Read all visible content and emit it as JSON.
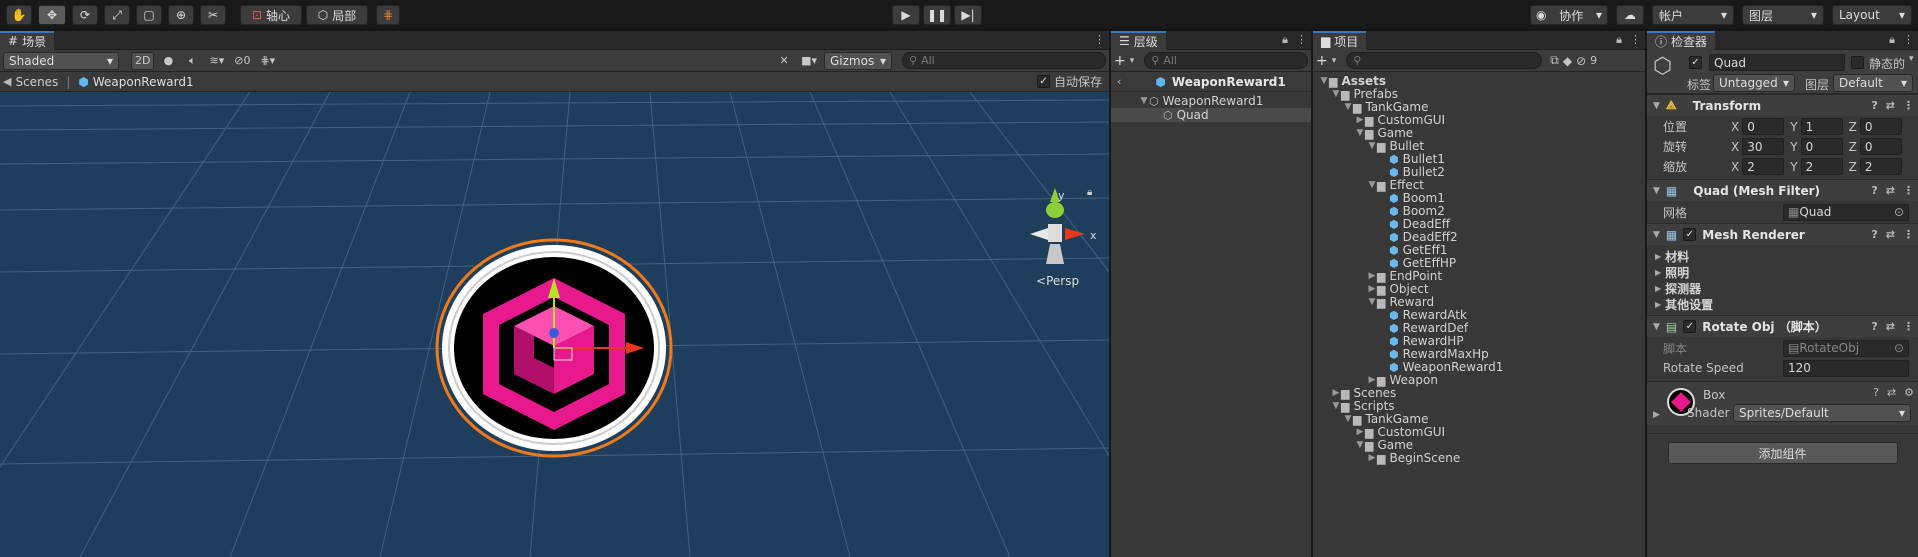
{
  "toolbar": {
    "pivot_label": "轴心",
    "local_label": "局部",
    "collab_label": "协作",
    "account_label": "帐户",
    "layers_label": "图层",
    "layout_label": "Layout"
  },
  "scene": {
    "tab_label": "场景",
    "shading": "Shaded",
    "mode_2d": "2D",
    "hidden_count": "0",
    "gizmos_label": "Gizmos",
    "search_placeholder": "All",
    "breadcrumb_root": "Scenes",
    "breadcrumb_prefab": "WeaponReward1",
    "autosave_label": "自动保存",
    "persp_label": "Persp",
    "gizmo_y": "y",
    "gizmo_x": "x"
  },
  "hierarchy": {
    "tab_label": "层级",
    "search_placeholder": "All",
    "prefab_header": "WeaponReward1",
    "items": [
      {
        "label": "WeaponReward1",
        "depth": 0
      },
      {
        "label": "Quad",
        "depth": 1
      }
    ]
  },
  "project": {
    "tab_label": "项目",
    "hidden_count": "9",
    "tree": [
      {
        "label": "Assets",
        "depth": 0,
        "open": true,
        "bold": true
      },
      {
        "label": "Prefabs",
        "depth": 1,
        "open": true
      },
      {
        "label": "TankGame",
        "depth": 2,
        "open": true
      },
      {
        "label": "CustomGUI",
        "depth": 3,
        "open": false
      },
      {
        "label": "Game",
        "depth": 3,
        "open": true
      },
      {
        "label": "Bullet",
        "depth": 4,
        "open": true
      },
      {
        "label": "Bullet1",
        "depth": 5,
        "asset": true
      },
      {
        "label": "Bullet2",
        "depth": 5,
        "asset": true
      },
      {
        "label": "Effect",
        "depth": 4,
        "open": true
      },
      {
        "label": "Boom1",
        "depth": 5,
        "asset": true
      },
      {
        "label": "Boom2",
        "depth": 5,
        "asset": true
      },
      {
        "label": "DeadEff",
        "depth": 5,
        "asset": true
      },
      {
        "label": "DeadEff2",
        "depth": 5,
        "asset": true
      },
      {
        "label": "GetEff1",
        "depth": 5,
        "asset": true
      },
      {
        "label": "GetEffHP",
        "depth": 5,
        "asset": true
      },
      {
        "label": "EndPoint",
        "depth": 4,
        "open": false
      },
      {
        "label": "Object",
        "depth": 4,
        "open": false
      },
      {
        "label": "Reward",
        "depth": 4,
        "open": true
      },
      {
        "label": "RewardAtk",
        "depth": 5,
        "asset": true
      },
      {
        "label": "RewardDef",
        "depth": 5,
        "asset": true
      },
      {
        "label": "RewardHP",
        "depth": 5,
        "asset": true
      },
      {
        "label": "RewardMaxHp",
        "depth": 5,
        "asset": true
      },
      {
        "label": "WeaponReward1",
        "depth": 5,
        "asset": true
      },
      {
        "label": "Weapon",
        "depth": 4,
        "open": false
      },
      {
        "label": "Scenes",
        "depth": 1,
        "open": false
      },
      {
        "label": "Scripts",
        "depth": 1,
        "open": true
      },
      {
        "label": "TankGame",
        "depth": 2,
        "open": true
      },
      {
        "label": "CustomGUI",
        "depth": 3,
        "open": false
      },
      {
        "label": "Game",
        "depth": 3,
        "open": true
      },
      {
        "label": "BeginScene",
        "depth": 4,
        "open": false
      }
    ]
  },
  "inspector": {
    "tab_label": "检查器",
    "object_name": "Quad",
    "static_label": "静态的",
    "tag_label": "标签",
    "tag_value": "Untagged",
    "layer_label": "图层",
    "layer_value": "Default",
    "transform": {
      "title": "Transform",
      "position_label": "位置",
      "rotation_label": "旋转",
      "scale_label": "缩放",
      "position": {
        "x": "0",
        "y": "1",
        "z": "0"
      },
      "rotation": {
        "x": "30",
        "y": "0",
        "z": "0"
      },
      "scale": {
        "x": "2",
        "y": "2",
        "z": "2"
      }
    },
    "mesh_filter": {
      "title": "Quad (Mesh Filter)",
      "mesh_label": "网格",
      "mesh_value": "Quad"
    },
    "mesh_renderer": {
      "title": "Mesh Renderer",
      "sections": [
        "材料",
        "照明",
        "探测器",
        "其他设置"
      ]
    },
    "rotate_obj": {
      "title": "Rotate Obj （脚本）",
      "script_label": "脚本",
      "script_value": "RotateObj",
      "speed_label": "Rotate Speed",
      "speed_value": "120"
    },
    "material": {
      "name": "Box",
      "shader_label": "Shader",
      "shader_value": "Sprites/Default"
    },
    "add_component_label": "添加组件"
  },
  "colors": {
    "scene_bg": "#1f3e5c",
    "accent": "#3a79bb",
    "reward_pink": "#e8198c",
    "selection_orange": "#f07a1a"
  }
}
